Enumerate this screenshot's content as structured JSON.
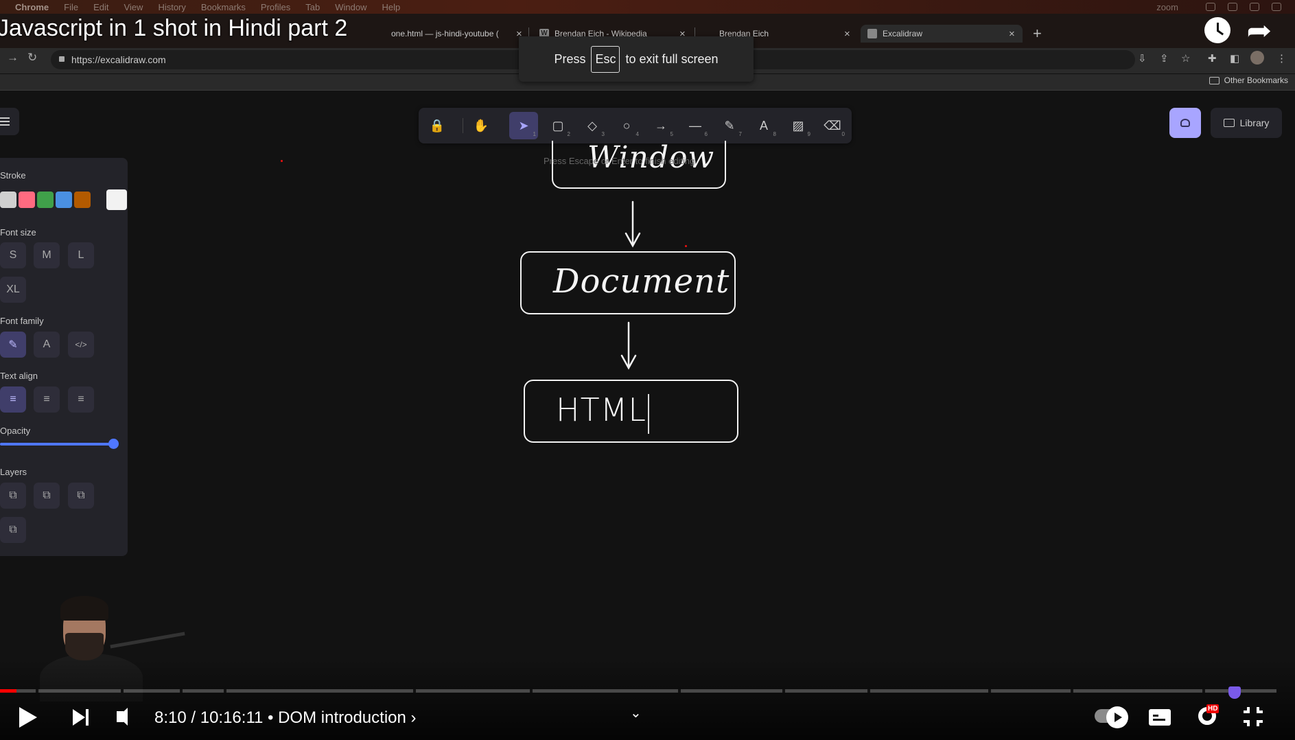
{
  "menubar": {
    "app": "Chrome",
    "items": [
      "File",
      "Edit",
      "View",
      "History",
      "Bookmarks",
      "Profiles",
      "Tab",
      "Window",
      "Help"
    ],
    "zoom": "zoom"
  },
  "video": {
    "title": "Javascript in 1 shot in Hindi part 2",
    "time": "8:10 / 10:16:11",
    "chapter": "• DOM introduction ›",
    "progress_fraction": 0.013
  },
  "tabs": [
    {
      "label": "one.html — js-hindi-youtube (",
      "favicon": ""
    },
    {
      "label": "Brendan Eich - Wikipedia",
      "favicon": "W"
    },
    {
      "label": "Brendan Eich",
      "favicon": ""
    },
    {
      "label": "Excalidraw",
      "favicon": ""
    }
  ],
  "address": {
    "url": "https://excalidraw.com"
  },
  "bookmarks": {
    "other": "Other Bookmarks"
  },
  "fullscreen_toast": {
    "press": "Press",
    "key": "Esc",
    "rest": "to exit full screen"
  },
  "toolbar": {
    "tools": [
      {
        "name": "lock-icon",
        "glyph": "🔒",
        "key": ""
      },
      {
        "name": "hand-icon",
        "glyph": "✋",
        "key": ""
      },
      {
        "name": "selection-icon",
        "glyph": "➤",
        "key": "1"
      },
      {
        "name": "rectangle-icon",
        "glyph": "▢",
        "key": "2"
      },
      {
        "name": "diamond-icon",
        "glyph": "◇",
        "key": "3"
      },
      {
        "name": "ellipse-icon",
        "glyph": "○",
        "key": "4"
      },
      {
        "name": "arrow-icon",
        "glyph": "→",
        "key": "5"
      },
      {
        "name": "line-icon",
        "glyph": "—",
        "key": "6"
      },
      {
        "name": "pencil-icon",
        "glyph": "✎",
        "key": "7"
      },
      {
        "name": "text-icon",
        "glyph": "A",
        "key": "8"
      },
      {
        "name": "image-icon",
        "glyph": "▨",
        "key": "9"
      },
      {
        "name": "eraser-icon",
        "glyph": "⌫",
        "key": "0"
      }
    ],
    "library_label": "Library"
  },
  "properties": {
    "stroke_label": "Stroke",
    "stroke_colors": [
      "#d0d0d0",
      "#ff6b81",
      "#40a04a",
      "#4a90e2",
      "#b35a00"
    ],
    "stroke_current": "#f2f2f2",
    "font_size_label": "Font size",
    "font_sizes": [
      "S",
      "M",
      "L",
      "XL"
    ],
    "font_family_label": "Font family",
    "font_family_glyphs": [
      "✎",
      "A",
      "</>"
    ],
    "text_align_label": "Text align",
    "text_align_glyphs": [
      "≡",
      "≡",
      "≡"
    ],
    "opacity_label": "Opacity",
    "opacity_value": 100,
    "layers_label": "Layers"
  },
  "canvas": {
    "hint": "Press Escape or Enter to finish editing",
    "nodes": [
      "Window",
      "Document",
      "HTML"
    ]
  }
}
